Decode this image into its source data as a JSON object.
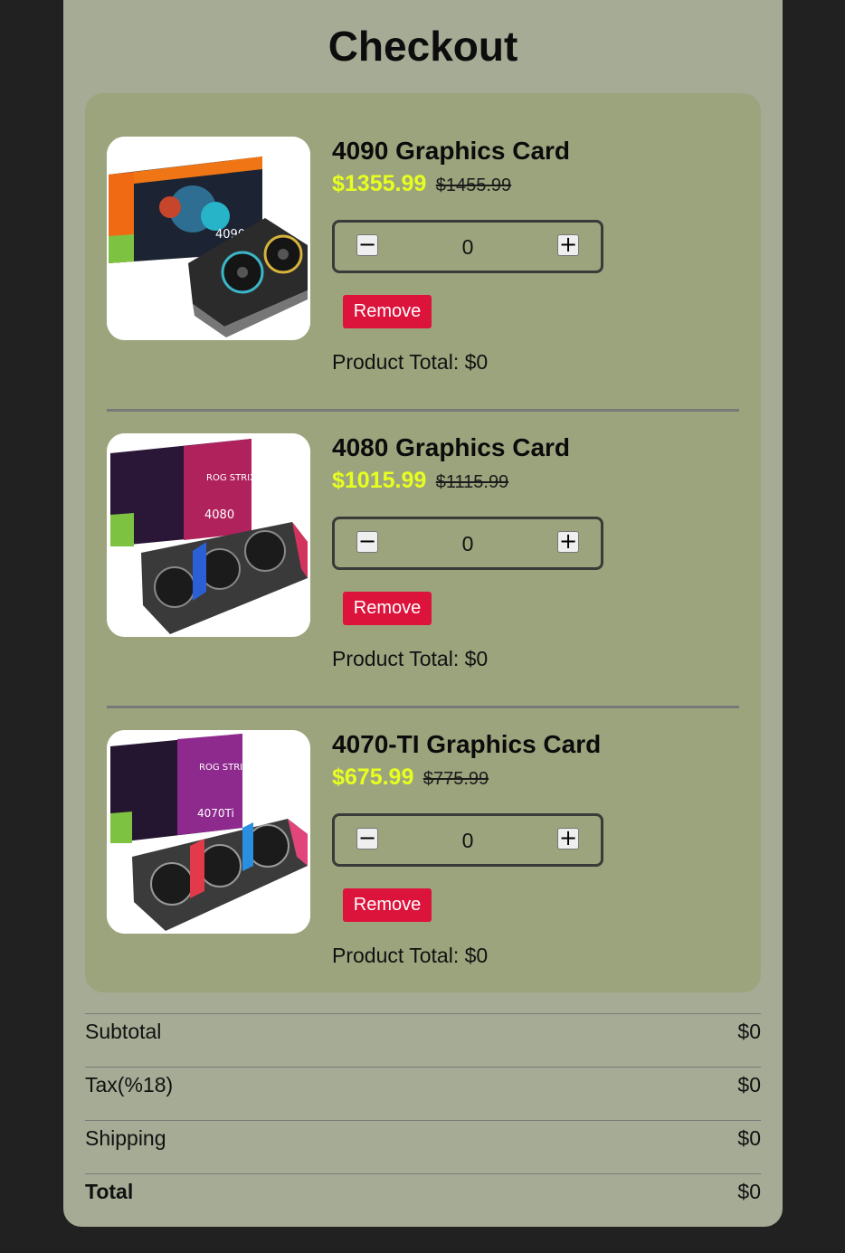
{
  "page": {
    "title": "Checkout"
  },
  "colors": {
    "background": "#212121",
    "panel": "#a5ab94",
    "cart": "#9ca47d",
    "sale_price": "#e7ff1f",
    "remove_button": "#dc143c"
  },
  "items": [
    {
      "name": "4090 Graphics Card",
      "price": "$1355.99",
      "old_price": "$1455.99",
      "quantity": "0",
      "minus_icon": "minus-icon",
      "plus_icon": "plus-icon",
      "minus_glyph": "−",
      "plus_glyph": "+",
      "remove_label": "Remove",
      "total_label": "Product Total: $0",
      "image": "gigabyte-rtx-4090-box-image",
      "box_model": "4090"
    },
    {
      "name": "4080 Graphics Card",
      "price": "$1015.99",
      "old_price": "$1115.99",
      "quantity": "0",
      "minus_icon": "minus-icon",
      "plus_icon": "plus-icon",
      "minus_glyph": "−",
      "plus_glyph": "+",
      "remove_label": "Remove",
      "total_label": "Product Total: $0",
      "image": "asus-rog-strix-4080-box-image",
      "box_model": "4080"
    },
    {
      "name": "4070-TI Graphics Card",
      "price": "$675.99",
      "old_price": "$775.99",
      "quantity": "0",
      "minus_icon": "minus-icon",
      "plus_icon": "plus-icon",
      "minus_glyph": "−",
      "plus_glyph": "+",
      "remove_label": "Remove",
      "total_label": "Product Total: $0",
      "image": "asus-rog-strix-4070ti-box-image",
      "box_model": "4070Ti"
    }
  ],
  "summary": {
    "subtotal_label": "Subtotal",
    "subtotal_value": "$0",
    "tax_label": "Tax(%18)",
    "tax_value": "$0",
    "shipping_label": "Shipping",
    "shipping_value": "$0",
    "total_label": "Total",
    "total_value": "$0"
  }
}
